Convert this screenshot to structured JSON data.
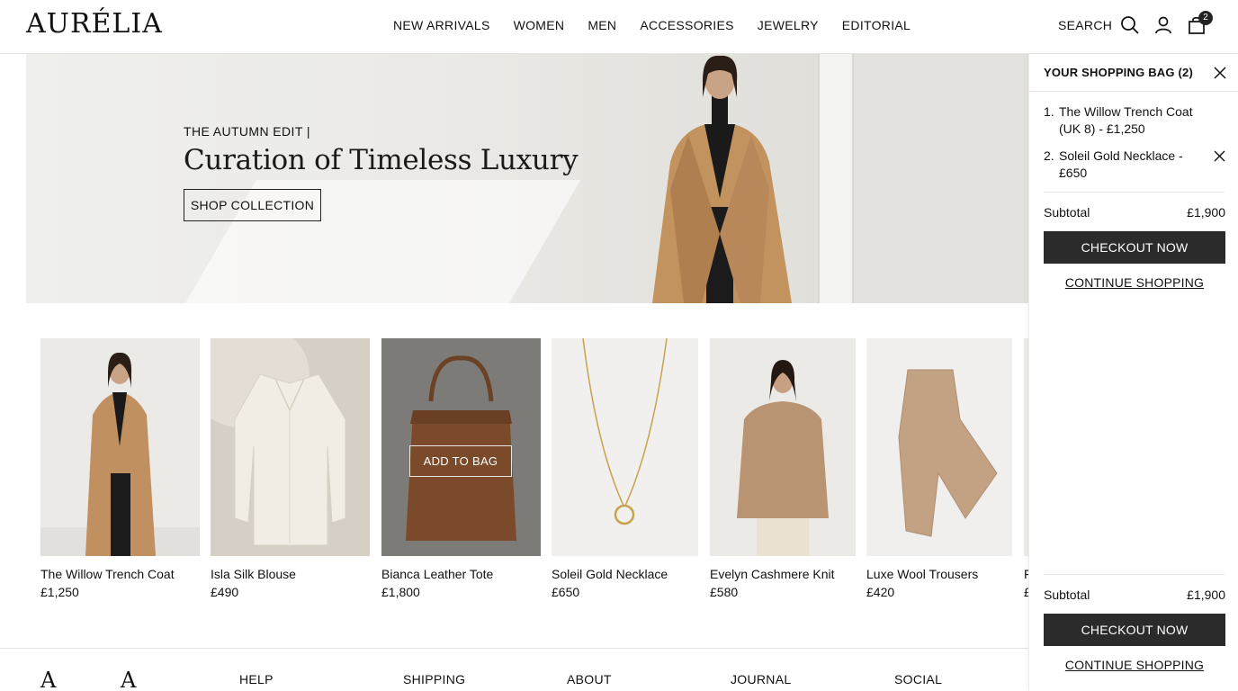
{
  "brand": {
    "logo": "AURÉLIA"
  },
  "nav": [
    "NEW ARRIVALS",
    "WOMEN",
    "MEN",
    "ACCESSORIES",
    "JEWELRY",
    "EDITORIAL"
  ],
  "header": {
    "search_label": "SEARCH",
    "bag_count": "2",
    "search_icon": "search-icon",
    "account_icon": "user-icon",
    "bag_icon": "shopping-bag-icon"
  },
  "hero": {
    "eyebrow": "THE AUTUMN EDIT |",
    "title": "Curation of Timeless Luxury",
    "cta": "SHOP COLLECTION"
  },
  "products": [
    {
      "name": "The Willow Trench Coat",
      "price": "£1,250"
    },
    {
      "name": "Isla Silk Blouse",
      "price": "£490"
    },
    {
      "name": "Bianca Leather Tote",
      "price": "£1,800",
      "hover_cta": "ADD TO BAG"
    },
    {
      "name": "Soleil Gold Necklace",
      "price": "£650"
    },
    {
      "name": "Evelyn Cashmere Knit",
      "price": "£580"
    },
    {
      "name": "Luxe Wool Trousers",
      "price": "£420"
    },
    {
      "name": "F",
      "price": "£"
    }
  ],
  "footer": {
    "marks": [
      "A",
      "A"
    ],
    "columns": [
      "HELP",
      "SHIPPING",
      "ABOUT",
      "JOURNAL",
      "SOCIAL"
    ]
  },
  "cart": {
    "title": "YOUR SHOPPING BAG (2)",
    "items": [
      {
        "num": "1.",
        "text": "The Willow Trench Coat (UK 8) - £1,250"
      },
      {
        "num": "2.",
        "text": "Soleil Gold Necklace - £650"
      }
    ],
    "subtotal_label": "Subtotal",
    "subtotal_value": "£1,900",
    "checkout": "CHECKOUT NOW",
    "continue": "CONTINUE SHOPPING"
  },
  "colors": {
    "dark_button": "#2b2b2b",
    "camel": "#b8875a",
    "hero_bg": "#ebeae6"
  }
}
